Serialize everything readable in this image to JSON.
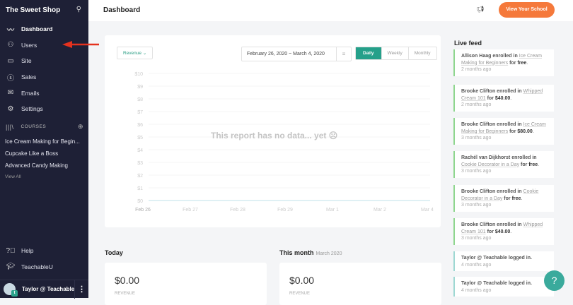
{
  "sidebar": {
    "brand": "The Sweet Shop",
    "search_icon": "search-icon",
    "items": [
      {
        "label": "Dashboard",
        "icon": "chart-line-icon"
      },
      {
        "label": "Users",
        "icon": "users-icon"
      },
      {
        "label": "Site",
        "icon": "devices-icon"
      },
      {
        "label": "Sales",
        "icon": "dollar-icon"
      },
      {
        "label": "Emails",
        "icon": "mail-icon"
      },
      {
        "label": "Settings",
        "icon": "gear-icon"
      }
    ],
    "courses_heading": "COURSES",
    "courses": [
      "Ice Cream Making for Begin...",
      "Cupcake Like a Boss",
      "Advanced Candy Making"
    ],
    "view_all": "View All",
    "bottom": [
      {
        "label": "Help",
        "icon": "help-icon"
      },
      {
        "label": "TeachableU",
        "icon": "graduation-icon"
      }
    ],
    "user": "Taylor @ Teachable"
  },
  "header": {
    "title": "Dashboard",
    "button": "View Your School"
  },
  "chart_panel": {
    "metric": "Revenue",
    "date_range": "February 26, 2020  ~  March 4, 2020",
    "periods": [
      "Daily",
      "Weekly",
      "Monthly"
    ],
    "active_period": "Daily",
    "empty_message": "This report has no data... yet ☹"
  },
  "chart_data": {
    "type": "line",
    "x": [
      "Feb 26",
      "Feb 27",
      "Feb 28",
      "Feb 29",
      "Mar 1",
      "Mar 2",
      "Mar 4"
    ],
    "y_ticks": [
      "$0",
      "$1",
      "$2",
      "$3",
      "$4",
      "$5",
      "$6",
      "$7",
      "$8",
      "$9",
      "$10"
    ],
    "ylim": [
      0,
      10
    ],
    "values": [
      0,
      0,
      0,
      0,
      0,
      0,
      0
    ],
    "grid": true
  },
  "today": {
    "heading": "Today",
    "value": "$0.00",
    "label": "REVENUE"
  },
  "month": {
    "heading": "This month",
    "sub": "March 2020",
    "value": "$0.00",
    "label": "REVENUE"
  },
  "feed": {
    "heading": "Live feed",
    "items": [
      {
        "who": "Allison Haag",
        "action": " enrolled in ",
        "course": "Ice Cream Making for Beginners",
        "for": " for ",
        "price": "free",
        "time": "2 months ago",
        "type": "enroll"
      },
      {
        "who": "Brooke Clifton",
        "action": " enrolled in ",
        "course": "Whipped Cream 101",
        "for": " for ",
        "price": "$40.00",
        "time": "2 months ago",
        "type": "enroll"
      },
      {
        "who": "Brooke Clifton",
        "action": " enrolled in ",
        "course": "Ice Cream Making for Beginners",
        "for": " for ",
        "price": "$80.00",
        "time": "3 months ago",
        "type": "enroll"
      },
      {
        "who": "Rachél van Dijkhorst",
        "action": " enrolled in ",
        "course": "Cookie Decorator in a Day",
        "for": " for ",
        "price": "free",
        "time": "3 months ago",
        "type": "enroll"
      },
      {
        "who": "Brooke Clifton",
        "action": " enrolled in ",
        "course": "Cookie Decorator in a Day",
        "for": " for ",
        "price": "free",
        "time": "3 months ago",
        "type": "enroll"
      },
      {
        "who": "Brooke Clifton",
        "action": " enrolled in ",
        "course": "Whipped Cream 101",
        "for": " for ",
        "price": "$40.00",
        "time": "3 months ago",
        "type": "enroll"
      },
      {
        "who": "Taylor @ Teachable",
        "action": " logged in.",
        "time": "4 months ago",
        "type": "login"
      },
      {
        "who": "Taylor @ Teachable",
        "action": " logged in.",
        "time": "4 months ago",
        "type": "login"
      }
    ]
  },
  "help_button": "?"
}
